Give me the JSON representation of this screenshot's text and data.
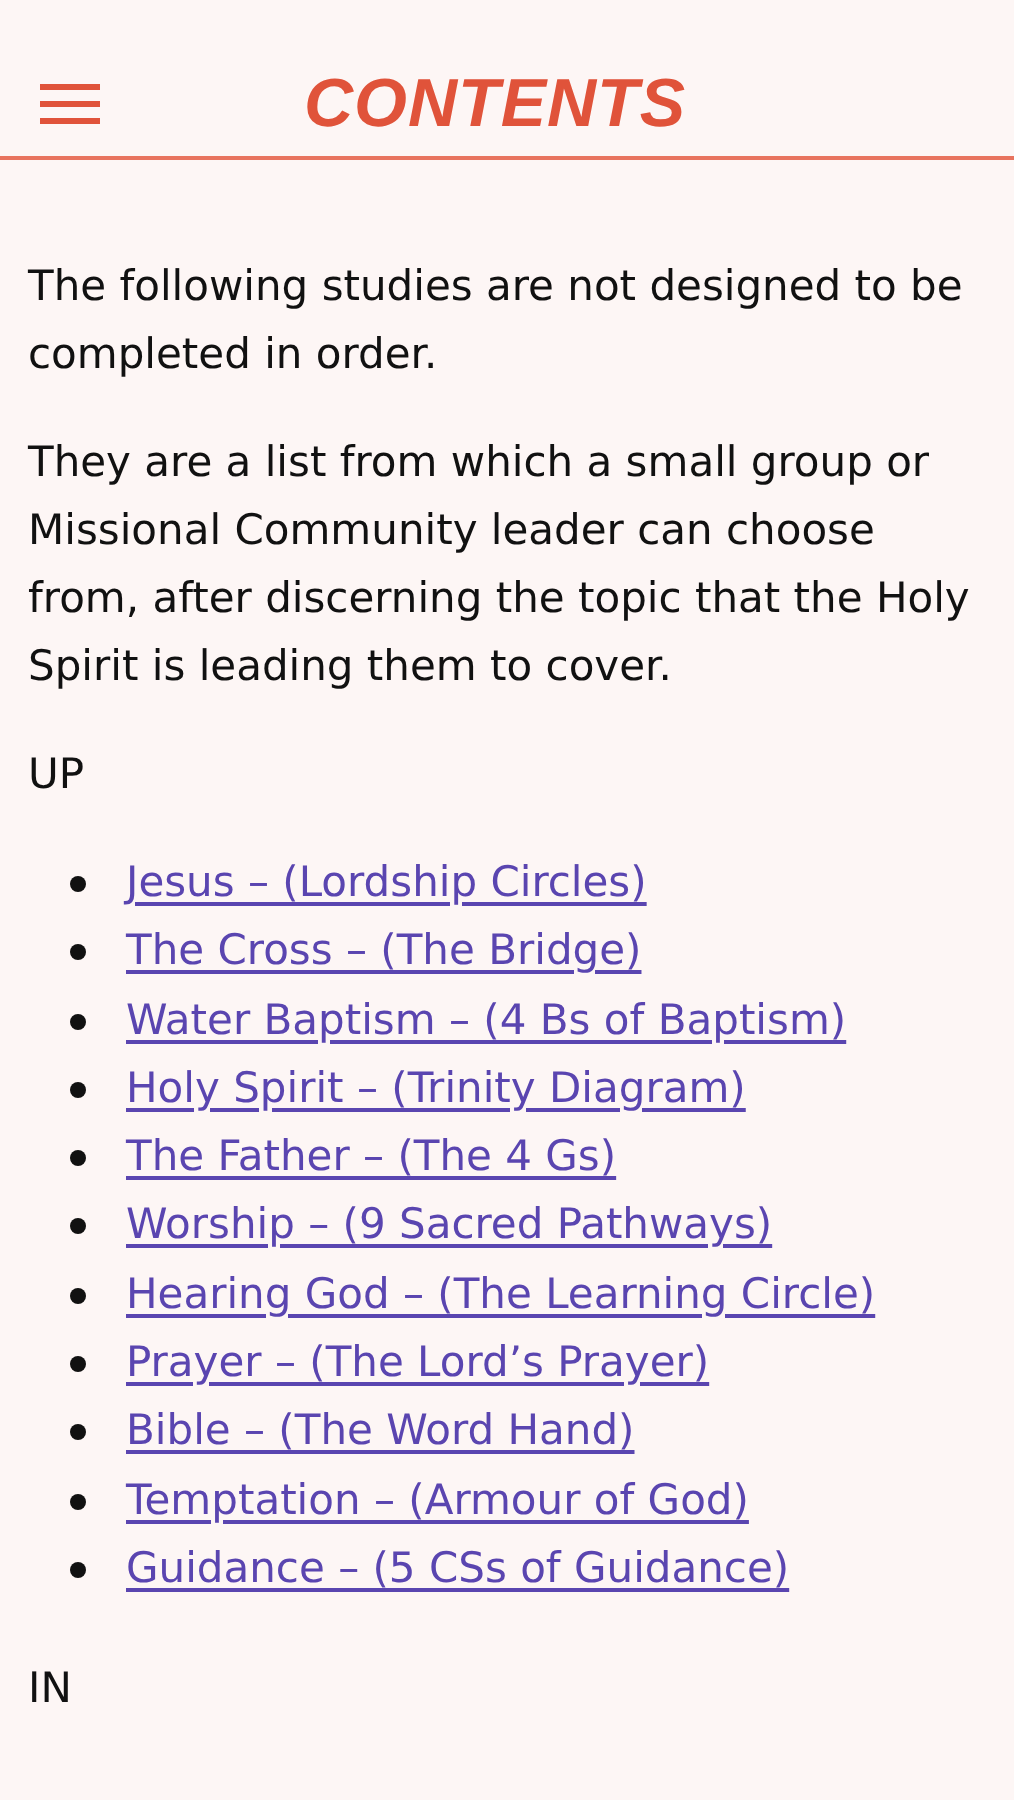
{
  "header": {
    "title": "CONTENTS"
  },
  "intro": [
    "The following studies are not designed to be completed in order.",
    "They are a list from which a small group or Missional Community leader can choose from, after discerning the topic that the Holy Spirit is leading them to cover."
  ],
  "sections": [
    {
      "heading": "UP",
      "links": [
        "Jesus – (Lordship Circles)",
        "The Cross – (The Bridge)",
        "Water Baptism – (4 Bs of Baptism)",
        "Holy Spirit – (Trinity Diagram)",
        "The Father – (The 4 Gs)",
        "Worship – (9 Sacred Pathways)",
        "Hearing God – (The Learning Circle)",
        "Prayer – (The Lord’s Prayer)",
        "Bible – (The Word Hand)",
        "Temptation – (Armour of God)",
        "Guidance – (5 CSs of Guidance)"
      ]
    },
    {
      "heading": "IN"
    }
  ]
}
